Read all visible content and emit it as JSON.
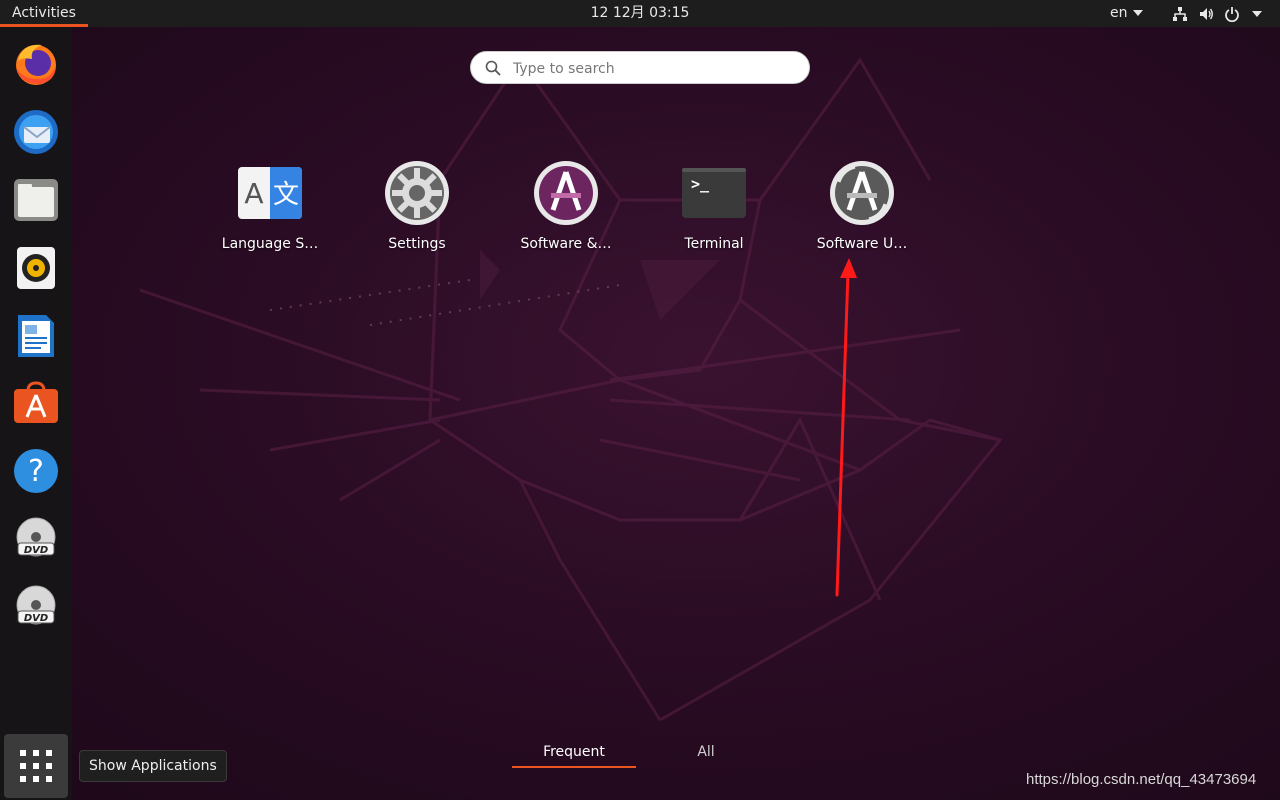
{
  "topbar": {
    "activities_label": "Activities",
    "clock": "12 12月  03:15",
    "language": "en",
    "tray_icons": [
      "network-icon",
      "volume-icon",
      "power-icon",
      "chevron-down-icon"
    ]
  },
  "dock": {
    "items": [
      {
        "name": "Firefox",
        "icon": "firefox-icon"
      },
      {
        "name": "Thunderbird",
        "icon": "thunderbird-icon"
      },
      {
        "name": "Files",
        "icon": "files-icon"
      },
      {
        "name": "Rhythmbox",
        "icon": "rhythmbox-icon"
      },
      {
        "name": "LibreOffice Writer",
        "icon": "writer-icon"
      },
      {
        "name": "Ubuntu Software",
        "icon": "ubuntu-software-icon"
      },
      {
        "name": "Help",
        "icon": "help-icon"
      },
      {
        "name": "DVD",
        "icon": "dvd-icon"
      },
      {
        "name": "DVD",
        "icon": "dvd-icon"
      }
    ],
    "show_apps_tooltip": "Show Applications"
  },
  "search": {
    "placeholder": "Type to search",
    "value": ""
  },
  "apps": [
    {
      "label": "Language S…",
      "icon": "language-support-icon"
    },
    {
      "label": "Settings",
      "icon": "settings-icon"
    },
    {
      "label": "Software &…",
      "icon": "software-sources-icon"
    },
    {
      "label": "Terminal",
      "icon": "terminal-icon"
    },
    {
      "label": "Software U…",
      "icon": "software-updater-icon"
    }
  ],
  "view_tabs": {
    "frequent": "Frequent",
    "all": "All",
    "active": "frequent"
  },
  "watermark": "https://blog.csdn.net/qq_43473694",
  "colors": {
    "accent": "#e95420",
    "topbar": "#1d1d1d",
    "annotation_arrow": "#ff1a1a"
  }
}
